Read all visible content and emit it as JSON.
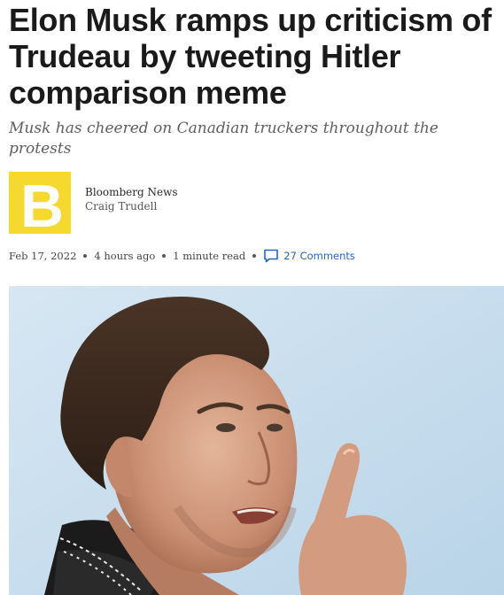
{
  "article": {
    "headline": "Elon Musk ramps up criticism of Trudeau by tweeting Hitler comparison meme",
    "subheadline": "Musk has cheered on Canadian truckers throughout the protests",
    "source": "Bloomberg News",
    "author": "Craig Trudell",
    "date": "Feb 17, 2022",
    "time_ago": "4 hours ago",
    "read_time": "1 minute read",
    "comments_label": "27 Comments"
  },
  "logo": {
    "letter": "B",
    "color": "#f6d92e"
  },
  "colors": {
    "link": "#2463c7",
    "headline": "#1a1a1a",
    "sky": "#c9dfee"
  },
  "icons": {
    "comments": "speech-bubble-icon"
  }
}
